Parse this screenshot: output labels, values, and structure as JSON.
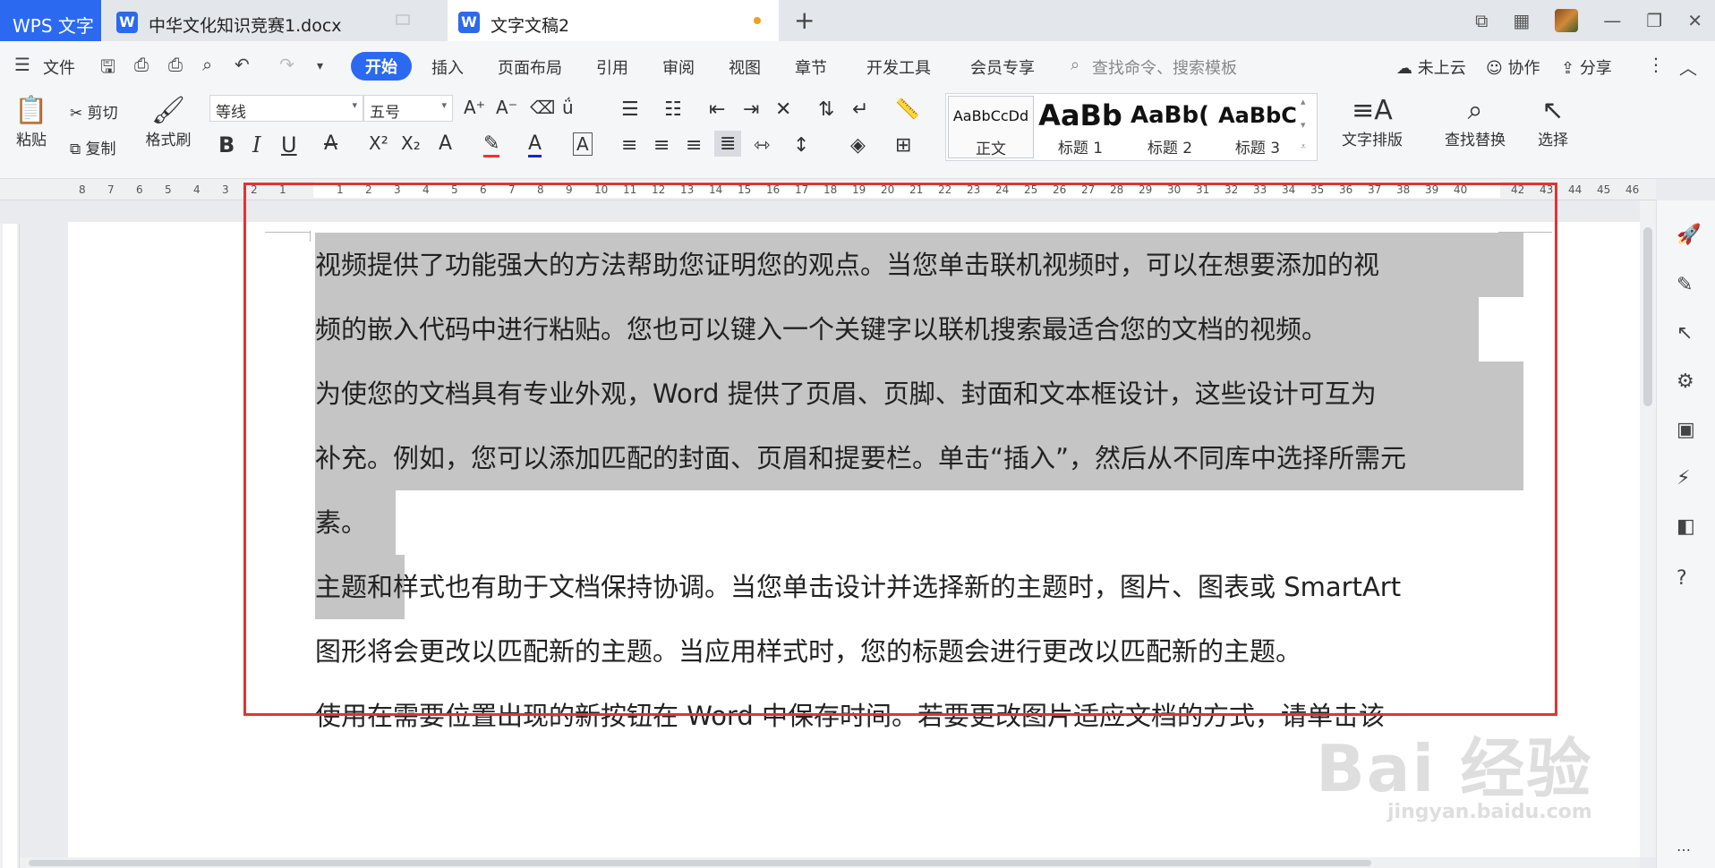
{
  "titlebar": {
    "app_tab": "WPS 文字",
    "doc_tab_1": "中华文化知识竞赛1.docx",
    "doc_tab_2": "文字文稿2",
    "new_tab": "+"
  },
  "menubar": {
    "file": "文件",
    "tabs": [
      "开始",
      "插入",
      "页面布局",
      "引用",
      "审阅",
      "视图",
      "章节",
      "开发工具",
      "会员专享"
    ],
    "search_placeholder": "查找命令、搜索模板",
    "cloud": "未上云",
    "collab": "协作",
    "share": "分享"
  },
  "ribbon": {
    "paste": "粘贴",
    "cut": "剪切",
    "copy": "复制",
    "format_painter": "格式刷",
    "font_name": "等线",
    "font_size": "五号",
    "styles": [
      {
        "preview": "AaBbCcDd",
        "name": "正文"
      },
      {
        "preview": "AaBb",
        "name": "标题 1"
      },
      {
        "preview": "AaBb(",
        "name": "标题 2"
      },
      {
        "preview": "AaBbC",
        "name": "标题 3"
      }
    ],
    "text_layout": "文字排版",
    "find_replace": "查找替换",
    "select": "选择"
  },
  "ruler": {
    "numbers": [
      "8",
      "7",
      "6",
      "5",
      "4",
      "3",
      "2",
      "1",
      "",
      "1",
      "2",
      "3",
      "4",
      "5",
      "6",
      "7",
      "8",
      "9",
      "10",
      "11",
      "12",
      "13",
      "14",
      "15",
      "16",
      "17",
      "18",
      "19",
      "20",
      "21",
      "22",
      "23",
      "24",
      "25",
      "26",
      "27",
      "28",
      "29",
      "30",
      "31",
      "32",
      "33",
      "34",
      "35",
      "36",
      "37",
      "38",
      "39",
      "40",
      "",
      "42",
      "43",
      "44",
      "45",
      "46"
    ]
  },
  "document": {
    "lines": [
      "视频提供了功能强大的方法帮助您证明您的观点。当您单击联机视频时，可以在想要添加的视",
      "频的嵌入代码中进行粘贴。您也可以键入一个关键字以联机搜索最适合您的文档的视频。",
      "为使您的文档具有专业外观，Word 提供了页眉、页脚、封面和文本框设计，这些设计可互为",
      "补充。例如，您可以添加匹配的封面、页眉和提要栏。单击“插入”，然后从不同库中选择所需元",
      "素。",
      "主题和样式也有助于文档保持协调。当您单击设计并选择新的主题时，图片、图表或 SmartArt",
      "图形将会更改以匹配新的主题。当应用样式时，您的标题会进行更改以匹配新的主题。",
      "使用在需要位置出现的新按钮在 Word 中保存时间。若要更改图片适应文档的方式，请单击该"
    ]
  },
  "watermark": {
    "text": "Bai 经验",
    "sub": "jingyan.baidu.com"
  },
  "colors": {
    "accent": "#2b6af0",
    "selection": "#c5c5c5",
    "annotation": "#e03434"
  }
}
